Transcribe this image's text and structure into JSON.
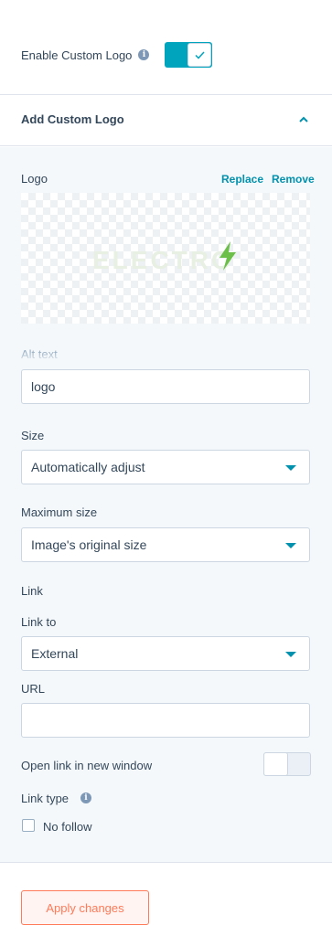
{
  "enable": {
    "label": "Enable Custom Logo",
    "info_icon": "info-icon",
    "toggle_on": true
  },
  "section": {
    "title": "Add Custom Logo",
    "expanded": true
  },
  "logo": {
    "label": "Logo",
    "replace": "Replace",
    "remove": "Remove",
    "preview_text": "ELECTRO"
  },
  "alt": {
    "label": "Alt text",
    "value": "logo"
  },
  "size": {
    "label": "Size",
    "selected": "Automatically adjust"
  },
  "max_size": {
    "label": "Maximum size",
    "selected": "Image's original size"
  },
  "link": {
    "heading": "Link",
    "link_to_label": "Link to",
    "link_to_selected": "External",
    "url_label": "URL",
    "url_value": "",
    "new_window_label": "Open link in new window",
    "new_window_on": false,
    "link_type_label": "Link type",
    "no_follow_label": "No follow",
    "no_follow_checked": false
  },
  "footer": {
    "apply_label": "Apply changes"
  },
  "colors": {
    "accent": "#00a4bd",
    "link": "#0091ae",
    "apply": "#ff7a59",
    "bolt": "#6cc04a"
  }
}
